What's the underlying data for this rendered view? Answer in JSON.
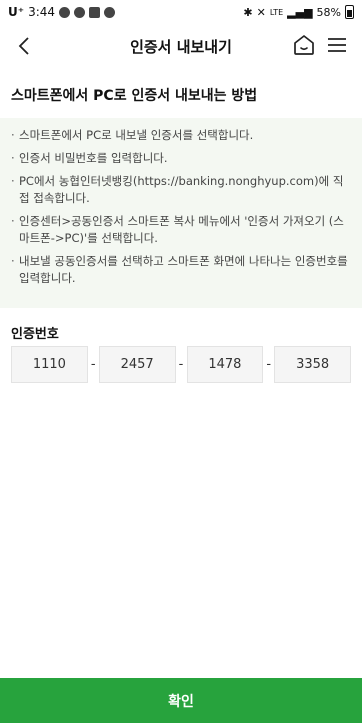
{
  "status_bar": {
    "carrier": "U⁺",
    "time": "3:44",
    "network": "LTE",
    "battery": "58%"
  },
  "header": {
    "title": "인증서 내보내기"
  },
  "guide": {
    "title": "스마트폰에서 PC로 인증서 내보내는 방법",
    "items": [
      "스마트폰에서 PC로 내보낼 인증서를 선택합니다.",
      "인증서 비밀번호를 입력합니다.",
      "PC에서 농협인터넷뱅킹(https://banking.nonghyup.com)에 직접 접속합니다.",
      "인증센터>공동인증서 스마트폰 복사 메뉴에서 '인증서 가져오기 (스마트폰->PC)'를 선택합니다.",
      "내보낼 공동인증서를 선택하고 스마트폰 화면에 나타나는 인증번호를 입력합니다."
    ]
  },
  "auth_code": {
    "label": "인증번호",
    "parts": [
      "1110",
      "2457",
      "1478",
      "3358"
    ],
    "separator": "-"
  },
  "footer": {
    "confirm_label": "확인"
  },
  "colors": {
    "accent": "#27a33d",
    "guide_background": "#f4f8f2"
  }
}
